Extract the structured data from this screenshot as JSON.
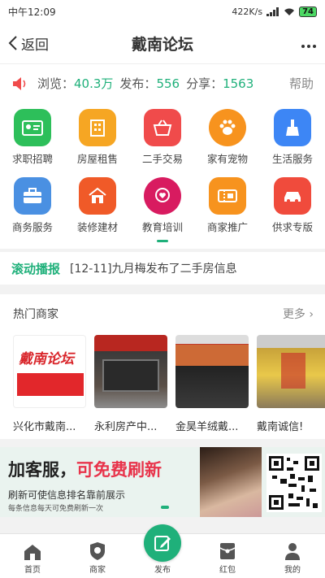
{
  "status_bar": {
    "time": "中午12:09",
    "speed": "422K/s",
    "battery": "74"
  },
  "nav": {
    "back_label": "返回",
    "title": "戴南论坛"
  },
  "stats": {
    "views_label": "浏览：",
    "views_value": "40.3万",
    "posts_label": "发布：",
    "posts_value": "556",
    "shares_label": "分享：",
    "shares_value": "1563",
    "help_label": "帮助"
  },
  "categories": [
    {
      "label": "求职招聘",
      "icon": "id-card-icon",
      "color": "#2dbf5a"
    },
    {
      "label": "房屋租售",
      "icon": "building-icon",
      "color": "#f6a623"
    },
    {
      "label": "二手交易",
      "icon": "basket-icon",
      "color": "#f04b4b"
    },
    {
      "label": "家有宠物",
      "icon": "paw-icon",
      "color": "#f7931e"
    },
    {
      "label": "生活服务",
      "icon": "broom-icon",
      "color": "#3d86f5"
    },
    {
      "label": "商务服务",
      "icon": "briefcase-icon",
      "color": "#4a90e2"
    },
    {
      "label": "装修建材",
      "icon": "house-icon",
      "color": "#f05a28"
    },
    {
      "label": "教育培训",
      "icon": "heart-pin-icon",
      "color": "#d81b60"
    },
    {
      "label": "商家推广",
      "icon": "ticket-icon",
      "color": "#f7931e"
    },
    {
      "label": "供求专版",
      "icon": "car-icon",
      "color": "#f04b3c"
    }
  ],
  "scroll_news": {
    "tag": "滚动播报",
    "text": "[12-11]九月梅发布了二手房信息"
  },
  "merchants": {
    "title": "热门商家",
    "more_label": "更多",
    "logo_text": "戴南论坛",
    "items": [
      {
        "name": "兴化市戴南..."
      },
      {
        "name": "永利房产中..."
      },
      {
        "name": "金昊羊绒戴..."
      },
      {
        "name": "戴南诚信!"
      }
    ]
  },
  "banner": {
    "main_prefix": "加客服，",
    "main_highlight": "可免费刷新",
    "sub": "刷新可使信息排名靠前展示",
    "small": "每条信息每天可免费刷新一次"
  },
  "tabs": [
    {
      "label": "首页"
    },
    {
      "label": "商家"
    },
    {
      "label": "发布"
    },
    {
      "label": "红包"
    },
    {
      "label": "我的"
    }
  ],
  "colors": {
    "accent": "#1fb07a",
    "highlight": "#e8334a"
  }
}
